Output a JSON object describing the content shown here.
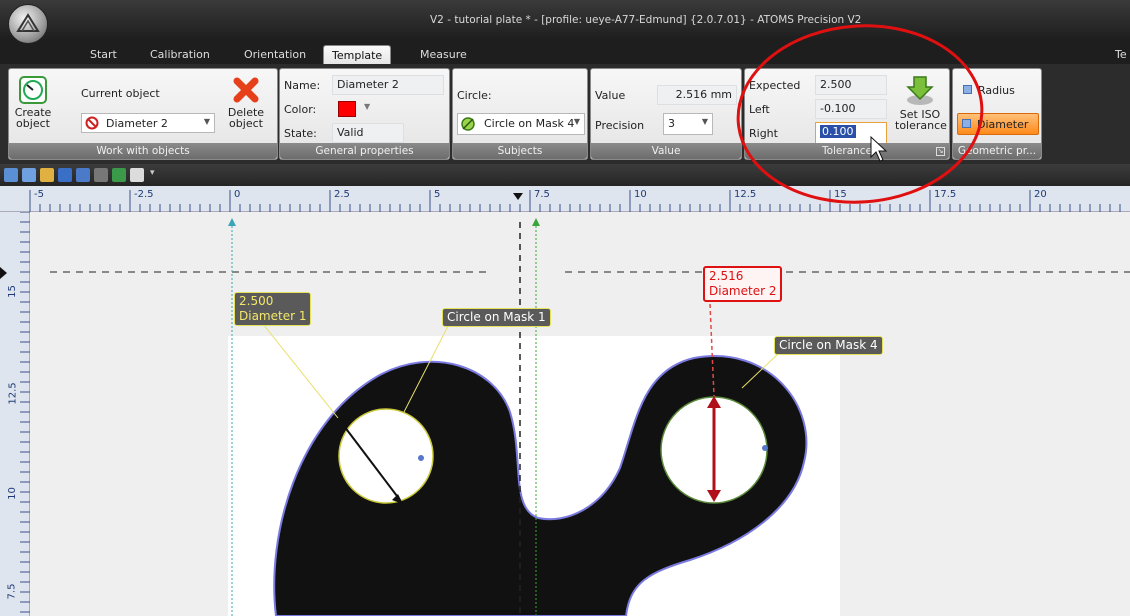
{
  "window": {
    "title": "V2 - tutorial plate * - [profile: ueye-A77-Edmund] {2.0.7.01} - ATOMS Precision V2"
  },
  "tabs": [
    {
      "label": "Start"
    },
    {
      "label": "Calibration"
    },
    {
      "label": "Orientation"
    },
    {
      "label": "Template",
      "active": true
    },
    {
      "label": "Measure"
    },
    {
      "label": "Te"
    }
  ],
  "ribbon": {
    "work_with_objects": {
      "group_label": "Work with objects",
      "create_label": "Create",
      "create_label2": "object",
      "current_object_label": "Current object",
      "current_object_value": "Diameter 2",
      "delete_label": "Delete",
      "delete_label2": "object"
    },
    "general_properties": {
      "group_label": "General properties",
      "name_label": "Name:",
      "name_value": "Diameter 2",
      "color_label": "Color:",
      "color_value": "#ff0000",
      "state_label": "State:",
      "state_value": "Valid"
    },
    "subjects": {
      "group_label": "Subjects",
      "circle_label": "Circle:",
      "circle_value": "Circle on Mask 4"
    },
    "value": {
      "group_label": "Value",
      "value_label": "Value",
      "value_value": "2.516 mm",
      "precision_label": "Precision",
      "precision_value": "3"
    },
    "tolerance": {
      "group_label": "Tolerance",
      "expected_label": "Expected",
      "expected_value": "2.500",
      "left_label": "Left",
      "left_value": "-0.100",
      "right_label": "Right",
      "right_value": "0.100",
      "set_iso_label": "Set ISO",
      "set_iso_label2": "tolerance"
    },
    "geometric": {
      "group_label": "Geometric pr...",
      "radius_label": "Radius",
      "diameter_label": "Diameter"
    }
  },
  "ruler": {
    "top_labels": [
      "-5",
      "-2.5",
      "0",
      "2.5",
      "5",
      "7.5",
      "10",
      "12.5",
      "15",
      "17.5",
      "20"
    ],
    "left_labels": [
      "15",
      "12.5",
      "10",
      "7.5"
    ]
  },
  "annotations": {
    "diameter1_value": "2.500",
    "diameter1_name": "Diameter 1",
    "mask1_label": "Circle on Mask 1",
    "diameter2_value": "2.516",
    "diameter2_name": "Diameter 2",
    "mask4_label": "Circle on Mask 4"
  },
  "colors": {
    "accent_red": "#dd0000",
    "callout_yellow": "#f3e86a",
    "circle_outline": "#7a7ae0",
    "diameter_active": "#ff9a2a"
  }
}
